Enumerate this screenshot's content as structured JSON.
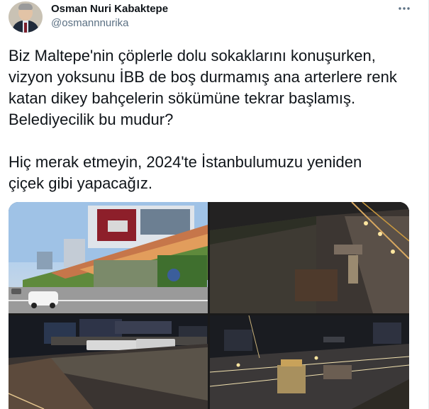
{
  "author": {
    "name": "Osman Nuri Kabaktepe",
    "handle": "@osmannnurika"
  },
  "tweet": {
    "text": "Biz Maltepe'nin çöplerle dolu sokaklarını konuşurken,\nvizyon yoksunu İBB de boş durmamış ana arterlere renk\nkatan dikey bahçelerin sökümüne tekrar başlamış.\nBelediyecilik bu mudur?\n\nHiç merak etmeyin, 2024'te İstanbulumuzu yeniden\nçiçek gibi yapacağız."
  },
  "icons": {
    "more": "more-options-icon"
  }
}
